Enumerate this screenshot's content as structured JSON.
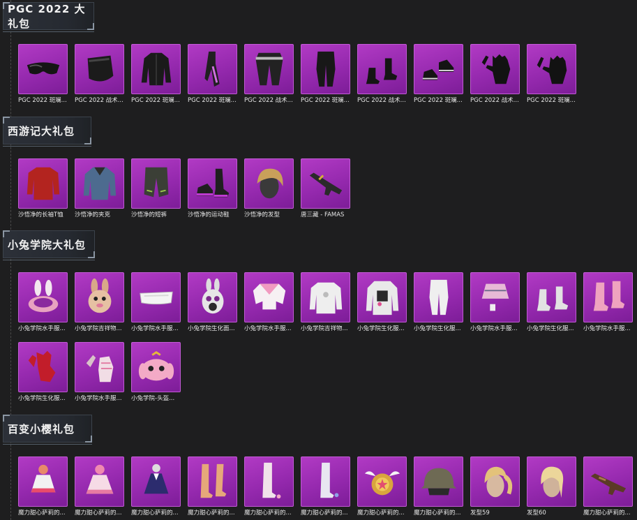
{
  "sections": [
    {
      "title": "PGC 2022 大礼包",
      "items": [
        {
          "label": "PGC 2022 斑斓...",
          "icon": "goggles-icon"
        },
        {
          "label": "PGC 2022 战术...",
          "icon": "face-mask-icon"
        },
        {
          "label": "PGC 2022 斑斓...",
          "icon": "jacket-icon"
        },
        {
          "label": "PGC 2022 斑斓...",
          "icon": "scarf-icon"
        },
        {
          "label": "PGC 2022 战术...",
          "icon": "tactical-pants-icon"
        },
        {
          "label": "PGC 2022 斑斓...",
          "icon": "pants-icon"
        },
        {
          "label": "PGC 2022 战术...",
          "icon": "boots-icon"
        },
        {
          "label": "PGC 2022 斑斓...",
          "icon": "shoes-icon"
        },
        {
          "label": "PGC 2022 战术...",
          "icon": "gloves-icon"
        },
        {
          "label": "PGC 2022 斑斓...",
          "icon": "gloves-icon"
        }
      ]
    },
    {
      "title": "西游记大礼包",
      "items": [
        {
          "label": "沙悟净的长袖T恤",
          "icon": "tshirt-icon"
        },
        {
          "label": "沙悟净的夹克",
          "icon": "denim-jacket-icon"
        },
        {
          "label": "沙悟净的短裤",
          "icon": "shorts-icon"
        },
        {
          "label": "沙悟净的运动鞋",
          "icon": "sneakers-icon"
        },
        {
          "label": "沙悟净的发型",
          "icon": "hairstyle-icon"
        },
        {
          "label": "唐三藏 - FAMAS",
          "icon": "rifle-icon"
        }
      ]
    },
    {
      "title": "小兔学院大礼包",
      "items": [
        {
          "label": "小兔学院水手服...",
          "icon": "bunny-hat-icon"
        },
        {
          "label": "小兔学院吉祥物...",
          "icon": "bunny-mask-icon"
        },
        {
          "label": "小兔学院水手服...",
          "icon": "visor-glasses-icon"
        },
        {
          "label": "小兔学院生化面...",
          "icon": "gas-mask-icon"
        },
        {
          "label": "小兔学院水手服...",
          "icon": "sailor-top-icon"
        },
        {
          "label": "小兔学院吉祥物...",
          "icon": "sweater-icon"
        },
        {
          "label": "小兔学院生化服...",
          "icon": "hazmat-suit-icon"
        },
        {
          "label": "小兔学院生化服...",
          "icon": "white-pants-icon"
        },
        {
          "label": "小兔学院水手服...",
          "icon": "skirt-icon"
        },
        {
          "label": "小兔学院生化服...",
          "icon": "white-boots-icon"
        },
        {
          "label": "小兔学院水手服...",
          "icon": "pink-boots-icon"
        },
        {
          "label": "小兔学院生化服...",
          "icon": "red-gloves-icon"
        },
        {
          "label": "小兔学院水手服...",
          "icon": "bunny-gloves-icon"
        },
        {
          "label": "小兔学院-头盔...",
          "icon": "bunny-helmet-icon"
        }
      ]
    },
    {
      "title": "百变小樱礼包",
      "items": [
        {
          "label": "魔力甜心萨莉的...",
          "icon": "dress-outfit-icon"
        },
        {
          "label": "魔力甜心萨莉的...",
          "icon": "dress-outfit-icon"
        },
        {
          "label": "魔力甜心萨莉的...",
          "icon": "dress-outfit-icon"
        },
        {
          "label": "魔力甜心萨莉的...",
          "icon": "thigh-boots-icon"
        },
        {
          "label": "魔力甜心萨莉的...",
          "icon": "thigh-boots-icon"
        },
        {
          "label": "魔力甜心萨莉的...",
          "icon": "thigh-boots-icon"
        },
        {
          "label": "魔力甜心萨莉的...",
          "icon": "winged-shield-icon"
        },
        {
          "label": "魔力甜心萨莉的...",
          "icon": "helmet-icon"
        },
        {
          "label": "发型59",
          "icon": "hairstyle-icon"
        },
        {
          "label": "发型60",
          "icon": "hairstyle-icon"
        },
        {
          "label": "魔力甜心萨莉的...",
          "icon": "rifle-icon"
        }
      ]
    }
  ],
  "colors": {
    "background": "#1e1e1f",
    "tile": "#9f2db8",
    "tile_border": "#c35bd6",
    "label": "#e6e6e6"
  }
}
